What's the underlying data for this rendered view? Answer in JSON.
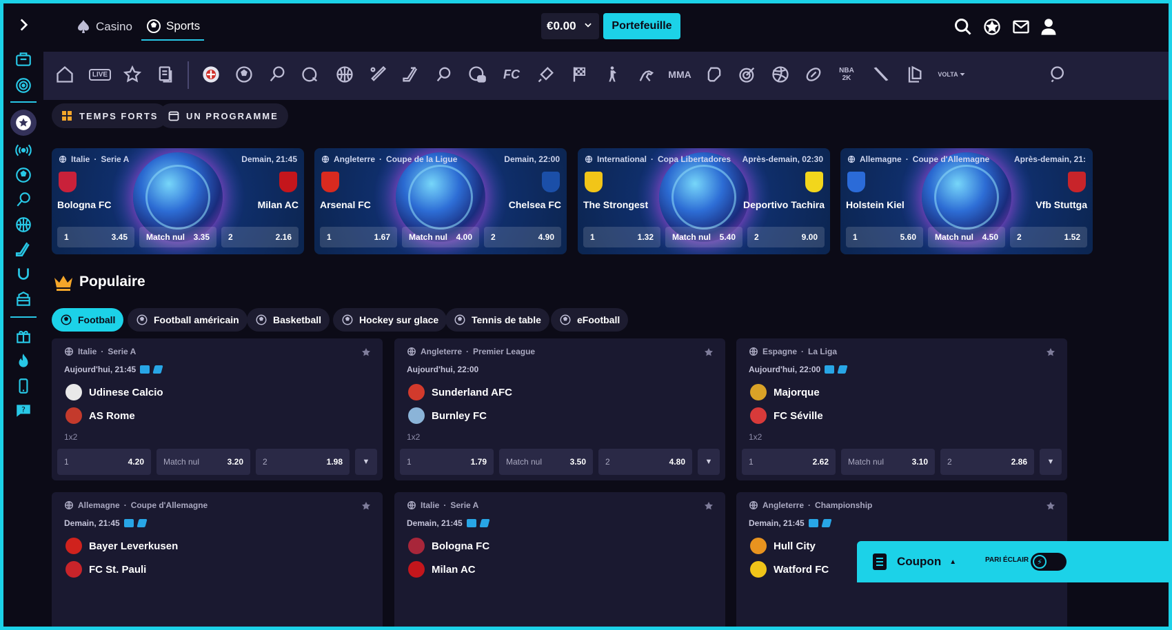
{
  "header": {
    "casino_label": "Casino",
    "sports_label": "Sports",
    "balance": "€0.00",
    "wallet_label": "Portefeuille"
  },
  "sportnav": {
    "live_label": "LIVE",
    "fc_label": "FC",
    "mma_label": "MMA",
    "nba_label": "NBA 2K",
    "volta_label": "VOLTA"
  },
  "modes": [
    {
      "label": "TEMPS FORTS"
    },
    {
      "label": "UN PROGRAMME"
    }
  ],
  "featured": [
    {
      "country": "Italie",
      "competition": "Serie A",
      "time": "Demain, 21:45",
      "home": "Bologna FC",
      "away": "Milan AC",
      "odds": [
        {
          "label": "1",
          "value": "3.45"
        },
        {
          "label": "Match nul",
          "value": "3.35"
        },
        {
          "label": "2",
          "value": "2.16"
        }
      ]
    },
    {
      "country": "Angleterre",
      "competition": "Coupe de la Ligue",
      "time": "Demain, 22:00",
      "home": "Arsenal FC",
      "away": "Chelsea FC",
      "odds": [
        {
          "label": "1",
          "value": "1.67"
        },
        {
          "label": "Match nul",
          "value": "4.00"
        },
        {
          "label": "2",
          "value": "4.90"
        }
      ]
    },
    {
      "country": "International",
      "competition": "Copa Libertadores",
      "time": "Après-demain, 02:30",
      "home": "The Strongest",
      "away": "Deportivo Tachira",
      "odds": [
        {
          "label": "1",
          "value": "1.32"
        },
        {
          "label": "Match nul",
          "value": "5.40"
        },
        {
          "label": "2",
          "value": "9.00"
        }
      ]
    },
    {
      "country": "Allemagne",
      "competition": "Coupe d'Allemagne",
      "time": "Après-demain, 21:",
      "home": "Holstein Kiel",
      "away": "Vfb Stuttga",
      "odds": [
        {
          "label": "1",
          "value": "5.60"
        },
        {
          "label": "Match nul",
          "value": "4.50"
        },
        {
          "label": "2",
          "value": "1.52"
        }
      ]
    }
  ],
  "popular": {
    "title": "Populaire",
    "filters": [
      {
        "label": "Football",
        "active": true
      },
      {
        "label": "Football américain"
      },
      {
        "label": "Basketball"
      },
      {
        "label": "Hockey sur glace"
      },
      {
        "label": "Tennis de table"
      },
      {
        "label": "eFootball"
      }
    ]
  },
  "matches": [
    {
      "country": "Italie",
      "competition": "Serie A",
      "time": "Aujourd'hui, 21:45",
      "home": "Udinese Calcio",
      "away": "AS Rome",
      "market": "1x2",
      "odds": [
        {
          "label": "1",
          "value": "4.20"
        },
        {
          "label": "Match nul",
          "value": "3.20"
        },
        {
          "label": "2",
          "value": "1.98"
        }
      ],
      "home_color": "#e9e9e9",
      "away_color": "#c43a2c"
    },
    {
      "country": "Angleterre",
      "competition": "Premier League",
      "time": "Aujourd'hui, 22:00",
      "home": "Sunderland AFC",
      "away": "Burnley FC",
      "market": "1x2",
      "odds": [
        {
          "label": "1",
          "value": "1.79"
        },
        {
          "label": "Match nul",
          "value": "3.50"
        },
        {
          "label": "2",
          "value": "4.80"
        }
      ],
      "home_color": "#d23a2c",
      "away_color": "#8bb4d8"
    },
    {
      "country": "Espagne",
      "competition": "La Liga",
      "time": "Aujourd'hui, 22:00",
      "home": "Majorque",
      "away": "FC Séville",
      "market": "1x2",
      "odds": [
        {
          "label": "1",
          "value": "2.62"
        },
        {
          "label": "Match nul",
          "value": "3.10"
        },
        {
          "label": "2",
          "value": "2.86"
        }
      ],
      "home_color": "#d9a227",
      "away_color": "#d83a3a"
    },
    {
      "country": "Allemagne",
      "competition": "Coupe d'Allemagne",
      "time": "Demain, 21:45",
      "home": "Bayer Leverkusen",
      "away": "FC St. Pauli",
      "market": "1x2",
      "odds": [],
      "home_color": "#d0221d",
      "away_color": "#c8242a"
    },
    {
      "country": "Italie",
      "competition": "Serie A",
      "time": "Demain, 21:45",
      "home": "Bologna FC",
      "away": "Milan AC",
      "market": "1x2",
      "odds": [],
      "home_color": "#a8263a",
      "away_color": "#c4161c"
    },
    {
      "country": "Angleterre",
      "competition": "Championship",
      "time": "Demain, 21:45",
      "home": "Hull City",
      "away": "Watford FC",
      "market": "1x2",
      "odds": [],
      "home_color": "#e8931f",
      "away_color": "#f0c419"
    }
  ],
  "coupon": {
    "label": "Coupon",
    "flash_label": "PARI ÉCLAIR"
  },
  "colors": {
    "accent": "#1cd2e8",
    "background": "#0c0b17",
    "nav": "#201f3a",
    "card": "#1a1930"
  }
}
